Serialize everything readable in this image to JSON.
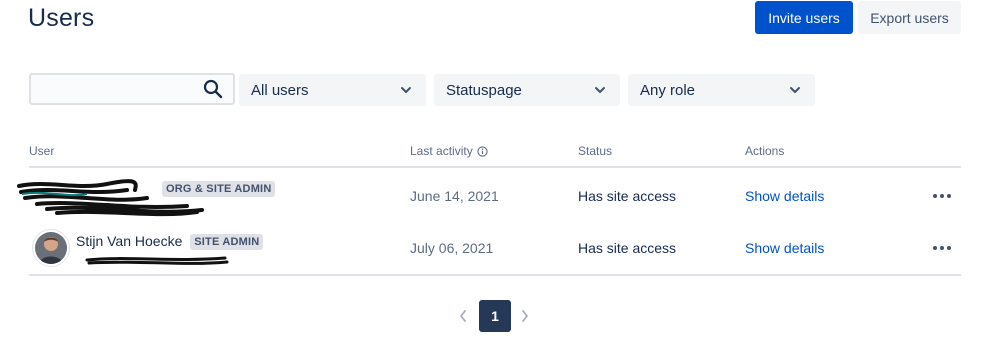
{
  "header": {
    "title": "Users",
    "invite_label": "Invite users",
    "export_label": "Export users"
  },
  "filters": {
    "search_value": "",
    "search_icon": "search-icon",
    "user_filter": "All users",
    "product_filter": "Statuspage",
    "role_filter": "Any role"
  },
  "table": {
    "columns": {
      "user": "User",
      "last_activity": "Last activity",
      "status": "Status",
      "actions": "Actions"
    },
    "rows": [
      {
        "name": "",
        "badge": "ORG & SITE ADMIN",
        "last_activity": "June 14, 2021",
        "status": "Has site access",
        "action": "Show details"
      },
      {
        "name": "Stijn Van Hoecke",
        "badge": "SITE ADMIN",
        "last_activity": "July 06, 2021",
        "status": "Has site access",
        "action": "Show details"
      }
    ]
  },
  "pagination": {
    "current_page": "1"
  },
  "colors": {
    "primary": "#0052cc",
    "text": "#172b4d",
    "subtle": "#5e6c84",
    "page_active": "#253858"
  }
}
